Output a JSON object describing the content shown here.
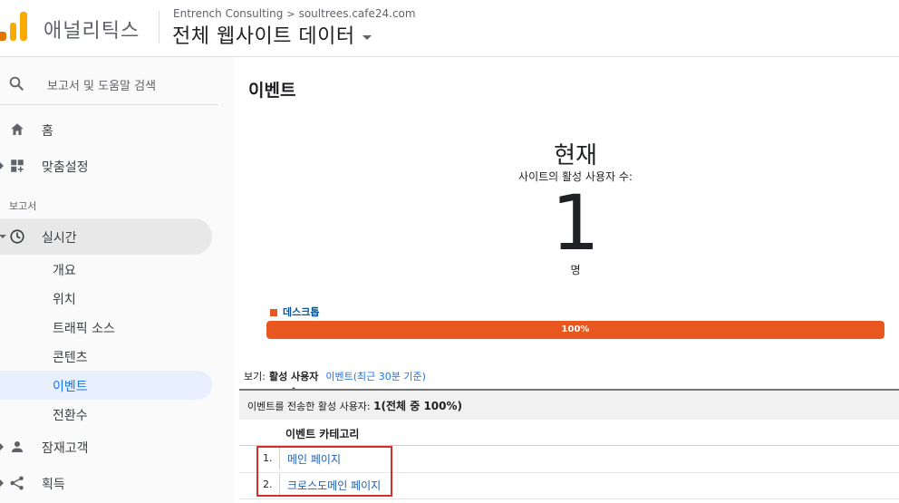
{
  "header": {
    "product_name": "애널리틱스",
    "account": "Entrench Consulting",
    "property": "soultrees.cafe24.com",
    "view_name": "전체 웹사이트 데이터"
  },
  "sidebar": {
    "search_label": "보고서 및 도움말 검색",
    "home": "홈",
    "customization": "맞춤설정",
    "reports_section": "보고서",
    "realtime": "실시간",
    "realtime_items": [
      "개요",
      "위치",
      "트래픽 소스",
      "콘텐츠",
      "이벤트",
      "전환수"
    ],
    "audience": "잠재고객",
    "acquisition": "획득"
  },
  "main": {
    "title": "이벤트",
    "now_label": "현재",
    "active_desc": "사이트의 활성 사용자 수:",
    "active_count": "1",
    "unit": "명",
    "device_legend": "데스크톱",
    "device_percent": "100%",
    "device_fraction": 1.0,
    "view_label": "보기:",
    "view_selected": "활성 사용자",
    "view_alt": "이벤트(최근 30분 기준)",
    "summary_prefix": "이벤트를 전송한 활성 사용자:",
    "summary_value": "1(전체 중 100%)",
    "table_header": "이벤트 카테고리",
    "rows": [
      {
        "num": "1.",
        "label": "메인 페이지"
      },
      {
        "num": "2.",
        "label": "크로스도메인 페이지"
      }
    ]
  },
  "colors": {
    "accent": "#e8571f",
    "link": "#1a5fb4",
    "highlight": "#d32f2f",
    "logo_orange": "#f9ab00"
  }
}
